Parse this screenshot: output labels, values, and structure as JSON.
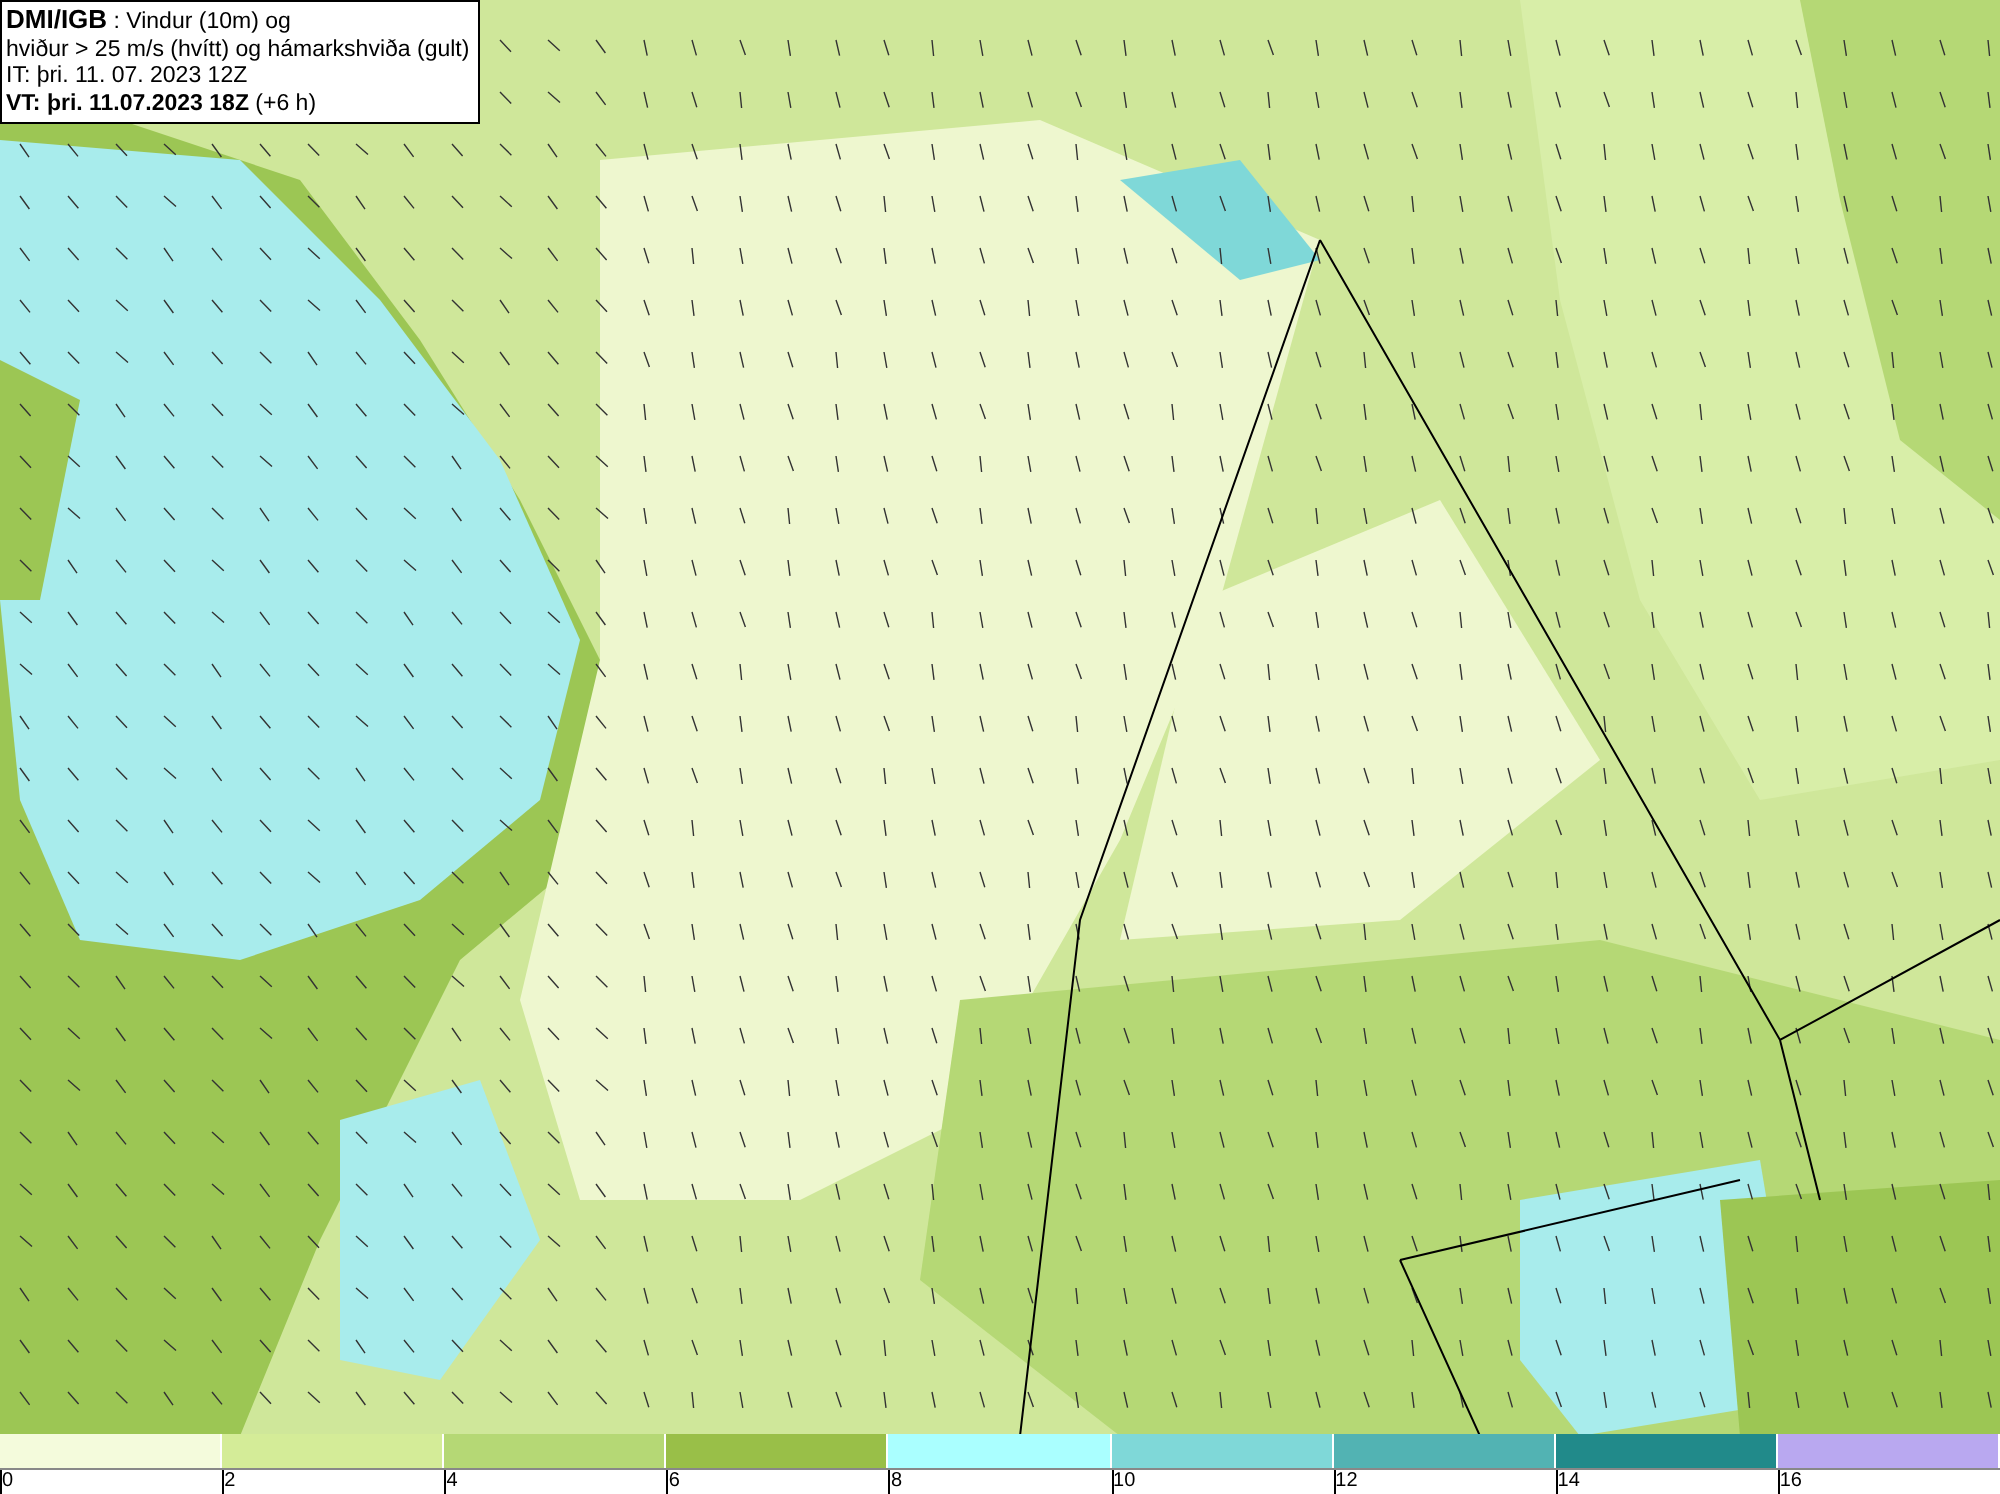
{
  "title_box": {
    "lines": [
      "**DMI/IGB** : Vindur (10m) og",
      "hviður > 25 m/s (hvítt) og hámarkshviða (gult)",
      "IT: þri. 11. 07. 2023 12Z",
      "**VT: þri. 11.07.2023 18Z** (+6 h)"
    ]
  },
  "legend": {
    "bins": [
      {
        "color": "#f4fbdc"
      },
      {
        "color": "#d4ec98"
      },
      {
        "color": "#b5d875"
      },
      {
        "color": "#99bf48"
      },
      {
        "color": "#aaffff"
      },
      {
        "color": "#7fd8d8"
      },
      {
        "color": "#52b3b3"
      },
      {
        "color": "#218a8a"
      },
      {
        "color": "#b9a8f0"
      }
    ],
    "ticks": [
      "0",
      "2",
      "4",
      "6",
      "8",
      "10",
      "12",
      "14",
      "16"
    ]
  }
}
